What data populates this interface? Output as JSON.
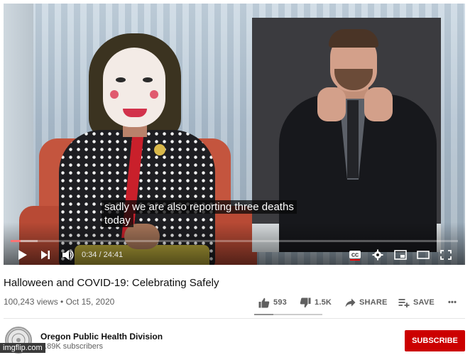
{
  "player": {
    "captions": [
      "sadly we are also reporting three deaths",
      "today"
    ],
    "time_current": "0:34",
    "time_separator": " / ",
    "time_total": "24:41",
    "progress_fraction": 0.023,
    "icons": [
      "play-icon",
      "next-icon",
      "volume-icon",
      "closed-captions-icon",
      "settings-icon",
      "miniplayer-icon",
      "theater-mode-icon",
      "fullscreen-icon"
    ]
  },
  "video": {
    "title": "Halloween and COVID-19: Celebrating Safely",
    "views": "100,243 views",
    "separator": " • ",
    "date": "Oct 15, 2020"
  },
  "actions": {
    "like_count": "593",
    "dislike_count": "1.5K",
    "share_label": "SHARE",
    "save_label": "SAVE",
    "more_label": "•••",
    "like_ratio": 0.28
  },
  "channel": {
    "name": "Oregon Public Health Division",
    "subscribers": "6.89K subscribers",
    "subscribe_label": "SUBSCRIBE"
  },
  "watermark": "imgflip.com",
  "colors": {
    "accent_red": "#ff0000",
    "subscribe_bg": "#cc0000",
    "text_primary": "#0f0f0f",
    "text_secondary": "#606060"
  }
}
